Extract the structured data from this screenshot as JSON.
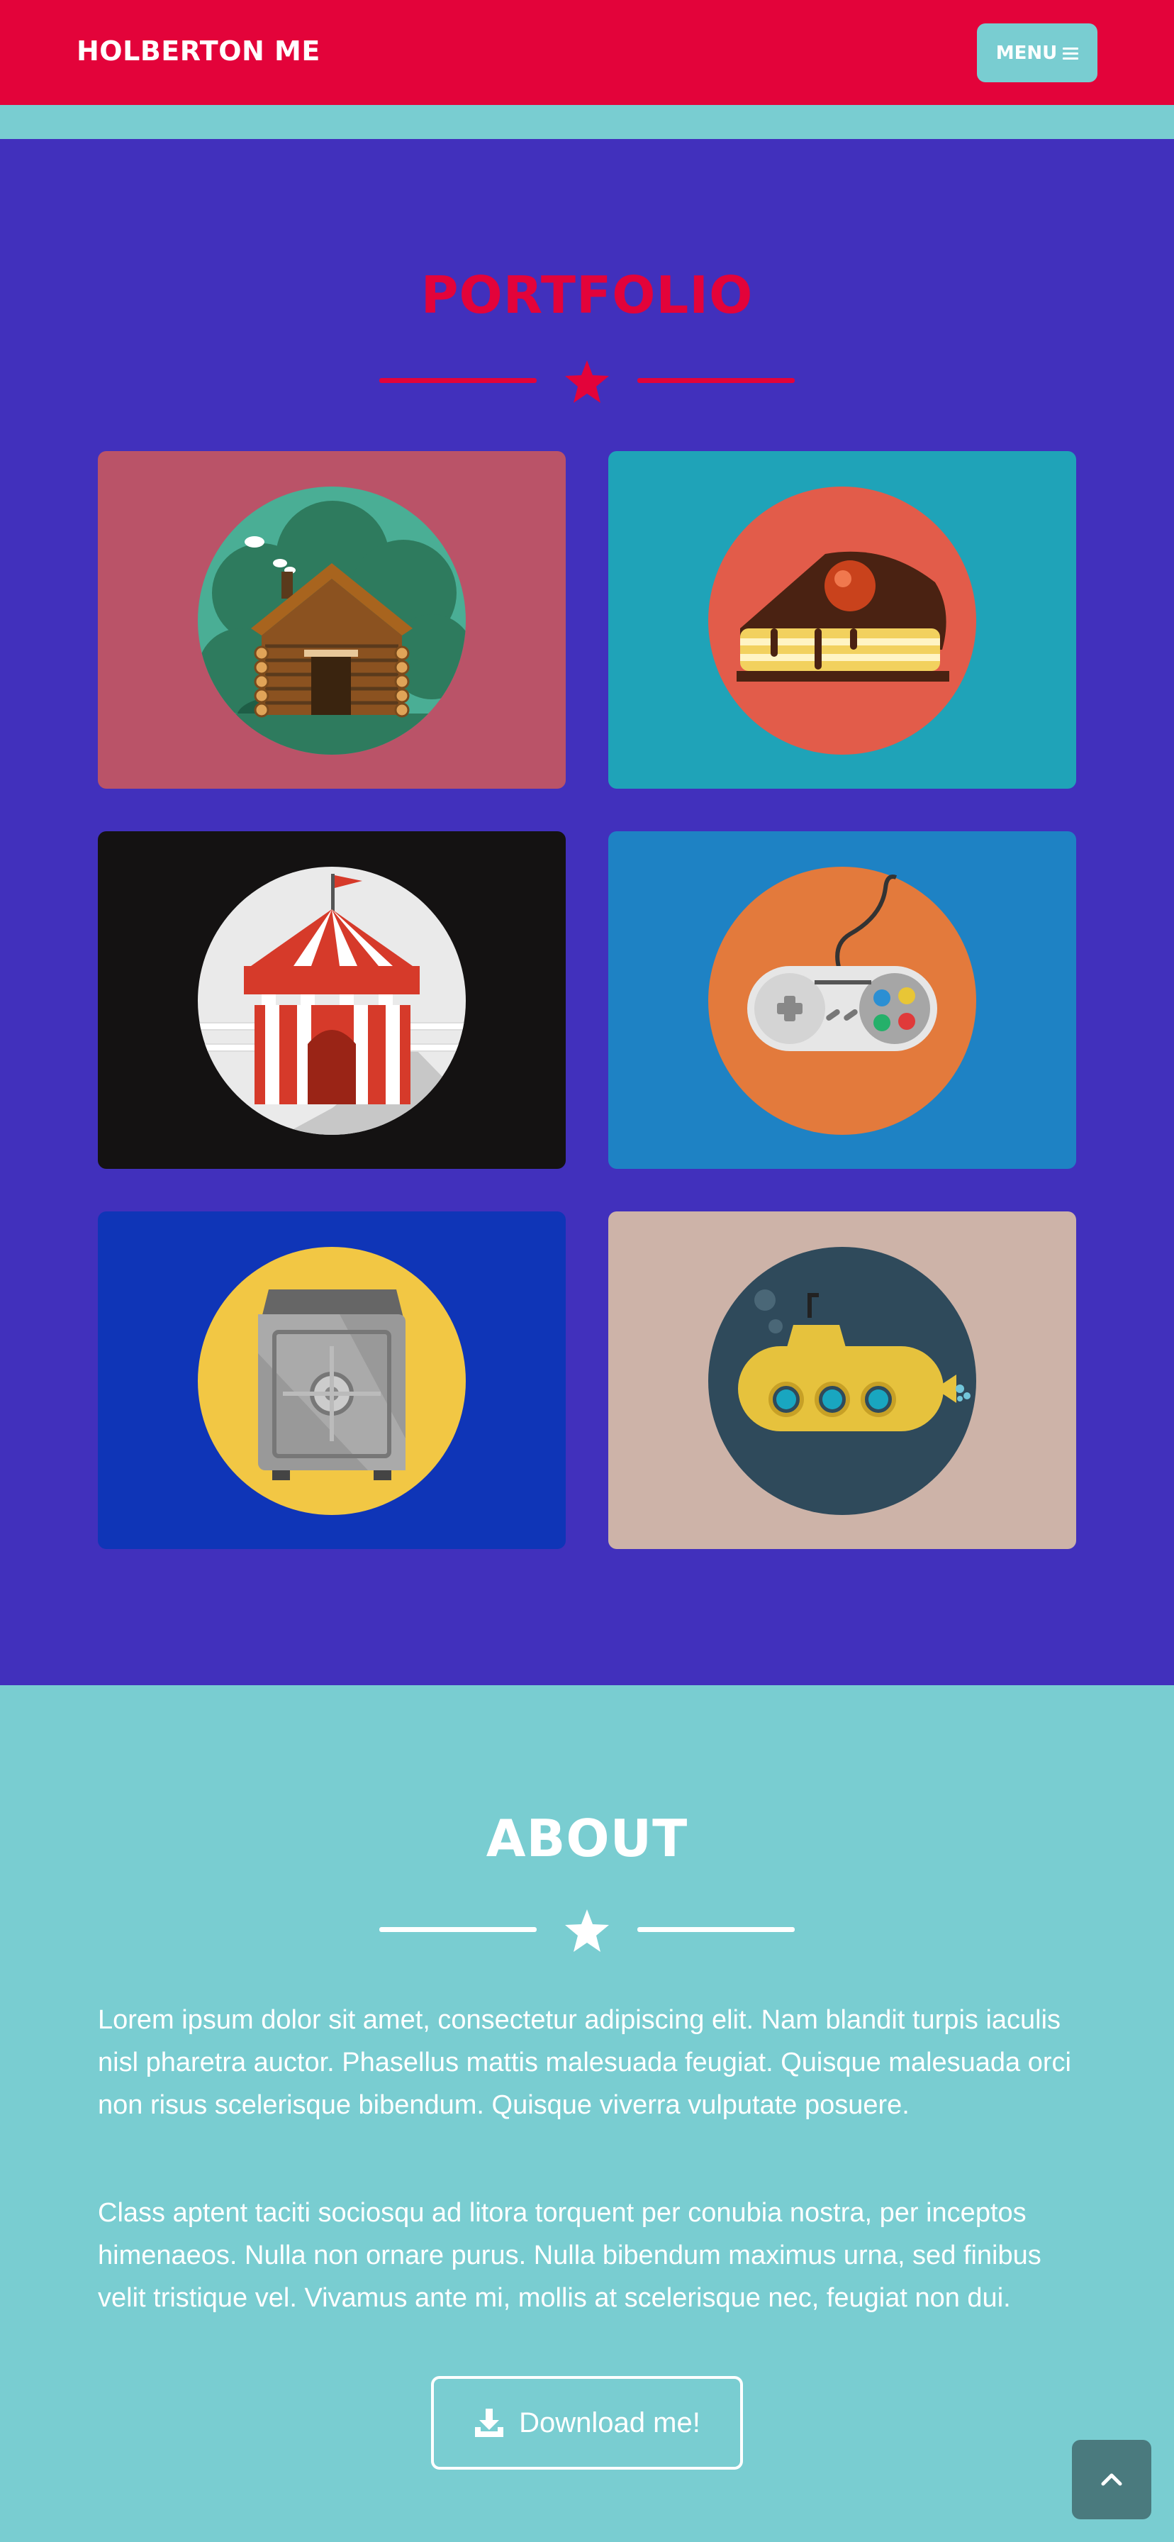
{
  "nav": {
    "brand": "HOLBERTON ME",
    "menu_label": "MENU",
    "menu_icon": "hamburger-icon"
  },
  "portfolio": {
    "title": "PORTFOLIO",
    "divider_icon": "star-icon",
    "items": [
      {
        "name": "log-cabin",
        "icon": "cabin-icon",
        "background": "#ba5368"
      },
      {
        "name": "cake",
        "icon": "cake-icon",
        "background": "#1fa3b8"
      },
      {
        "name": "circus-tent",
        "icon": "circus-tent-icon",
        "background": "#141212"
      },
      {
        "name": "game-controller",
        "icon": "game-controller-icon",
        "background": "#1e82c4"
      },
      {
        "name": "safe",
        "icon": "safe-icon",
        "background": "#0f35b7"
      },
      {
        "name": "submarine",
        "icon": "submarine-icon",
        "background": "#cdb3a8"
      }
    ]
  },
  "about": {
    "title": "ABOUT",
    "divider_icon": "star-icon",
    "paragraph_1": "Lorem ipsum dolor sit amet, consectetur adipiscing elit. Nam blandit turpis iaculis nisl pharetra auctor. Phasellus mattis malesuada feugiat. Quisque malesuada orci non risus scelerisque bibendum. Quisque viverra vulputate posuere.",
    "paragraph_2": "Class aptent taciti sociosqu ad litora torquent per conubia nostra, per inceptos himenaeos. Nulla non ornare purus. Nulla bibendum maximus urna, sed finibus velit tristique vel. Vivamus ante mi, mollis at scelerisque nec, feugiat non dui.",
    "download_label": "Download me!",
    "download_icon": "download-icon"
  },
  "scroll_top_icon": "chevron-up-icon",
  "colors": {
    "primary_red": "#e3033a",
    "teal": "#79cdd1",
    "purple": "#4130bc",
    "white": "#ffffff"
  }
}
